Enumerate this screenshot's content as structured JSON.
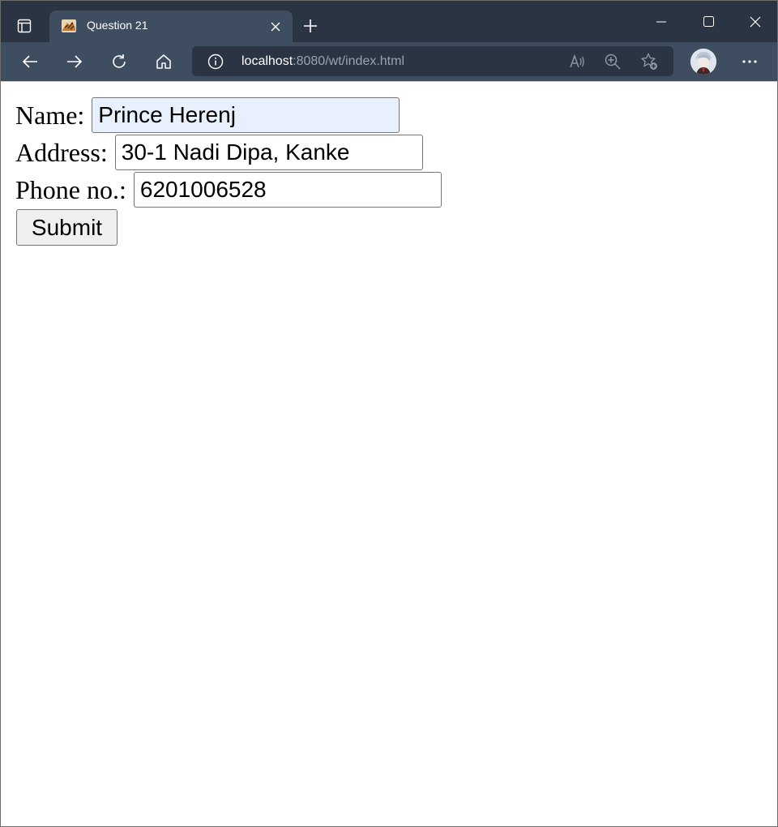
{
  "browser": {
    "tab": {
      "title": "Question 21"
    },
    "address": {
      "host": "localhost",
      "rest": ":8080/wt/index.html"
    },
    "icons": {
      "tab_actions": "tab-actions-icon",
      "favicon": "tiger-favicon-icon",
      "tab_close": "close-icon",
      "new_tab": "plus-icon",
      "minimize": "minimize-icon",
      "maximize": "maximize-icon",
      "close": "close-icon",
      "back": "arrow-left-icon",
      "forward": "arrow-right-icon",
      "refresh": "refresh-icon",
      "home": "home-icon",
      "info": "info-icon",
      "read_aloud": "read-aloud-icon",
      "zoom": "zoom-in-icon",
      "favorites": "star-add-icon",
      "profile": "avatar",
      "more": "more-icon"
    },
    "colors": {
      "titlebar": "#2b3442",
      "toolbar": "#3f4d60",
      "address_bg": "#2b3442",
      "autofill": "#e8f0fe"
    }
  },
  "form": {
    "name": {
      "label": "Name:",
      "value": "Prince Herenj"
    },
    "address": {
      "label": "Address:",
      "value": "30-1 Nadi Dipa, Kanke"
    },
    "phone": {
      "label": "Phone no.:",
      "value": "6201006528"
    },
    "submit_label": "Submit"
  }
}
